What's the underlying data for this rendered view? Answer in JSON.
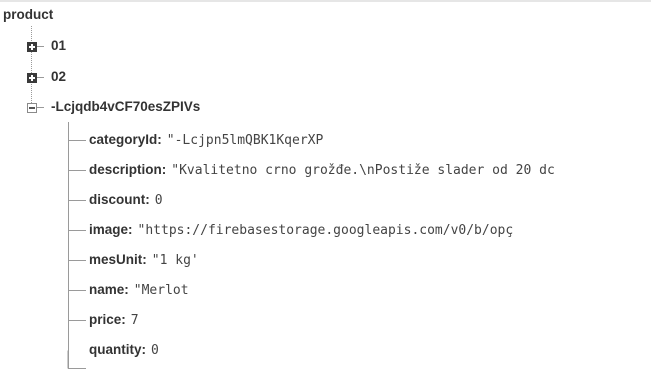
{
  "root": {
    "label": "product"
  },
  "nodes": [
    {
      "key": "01",
      "state": "collapsed"
    },
    {
      "key": "02",
      "state": "collapsed"
    },
    {
      "key": "-Lcjqdb4vCF70esZPIVs",
      "state": "expanded"
    }
  ],
  "fields": [
    {
      "key": "categoryId:",
      "value": "\"-Lcjpn5lmQBK1KqerXP"
    },
    {
      "key": "description:",
      "value": "\"Kvalitetno crno grožđe.\\nPostiže slader od 20 dc"
    },
    {
      "key": "discount:",
      "value": "0"
    },
    {
      "key": "image:",
      "value": "\"https://firebasestorage.googleapis.com/v0/b/opç"
    },
    {
      "key": "mesUnit:",
      "value": "\"1 kg'"
    },
    {
      "key": "name:",
      "value": "\"Merlot"
    },
    {
      "key": "price:",
      "value": "7"
    },
    {
      "key": "quantity:",
      "value": "0"
    }
  ],
  "colors": {
    "text": "#333333",
    "line": "#9a9a9a"
  }
}
